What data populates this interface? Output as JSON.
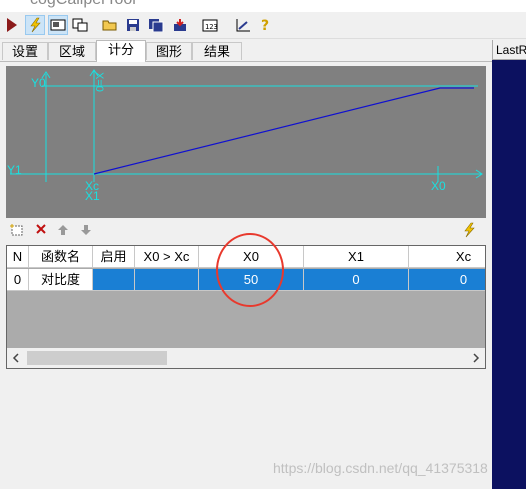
{
  "window": {
    "title": "cogCaliperTool"
  },
  "toolbar": {
    "icons": [
      "run-icon",
      "lightning-icon",
      "display-icon",
      "copy-icon",
      "open-folder-icon",
      "save-icon",
      "save-as-icon",
      "import-icon",
      "numeric-icon",
      "measure-icon",
      "help-icon"
    ]
  },
  "tabs": [
    "设置",
    "区域",
    "计分",
    "图形",
    "结果"
  ],
  "right_pane": {
    "header": "LastRun"
  },
  "chart": {
    "labels": {
      "y0": "Y0",
      "y1": "Y1",
      "xc": "Xc",
      "x1": "X1",
      "x0": "X0",
      "vertical": "X=0"
    }
  },
  "grid": {
    "headers": [
      "N",
      "函数名",
      "启用",
      "X0 > Xc",
      "X0",
      "X1",
      "Xc"
    ],
    "row": {
      "n": "0",
      "name": "对比度",
      "enabled": "",
      "x0_gt_xc": "",
      "x0": "50",
      "x1": "0",
      "xc": "0"
    }
  },
  "watermark": "https://blog.csdn.net/qq_41375318",
  "colors": {
    "selection": "#1a7fd4",
    "plot_bg": "#808080",
    "axis": "#19e0e0",
    "line": "#1010d0",
    "annotation": "#e8392d"
  }
}
